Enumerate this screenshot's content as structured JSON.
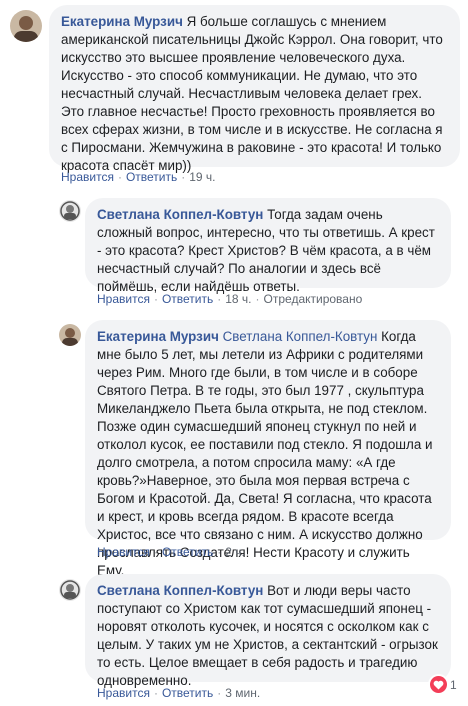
{
  "labels": {
    "like": "Нравится",
    "reply": "Ответить",
    "edited": "Отредактировано"
  },
  "comments": [
    {
      "author": "Екатерина Мурзич",
      "text": "Я больше соглашусь с мнением американской писательницы Джойс Кэррол. Она говорит, что искусство это высшее проявление человеческого духа. Искусство - это способ коммуникации. Не думаю, что это несчастный случай. Несчастливым человека делает грех. Это главное несчастье! Просто греховность проявляется во всех сферах жизни, в том числе и в искусстве. Не согласна я с Пиросмани. Жемчужина в раковине - это красота! И только красота спасёт мир))",
      "time": "19 ч."
    },
    {
      "author": "Светлана Коппел-Ковтун",
      "text": "Тогда задам очень сложный вопрос, интересно, что ты ответишь. А крест - это красота? Крест Христов? В чём красота, а в чём несчастный случай? По аналогии и здесь всё поймёшь, если найдёшь ответы.",
      "time": "18 ч."
    },
    {
      "author": "Екатерина Мурзич",
      "mention": "Светлана Коппел-Ковтун",
      "text": "Когда мне было 5 лет, мы летели из Африки с родителями через Рим. Много где были, в том числе и в соборе Святого Петра. В те годы, это был 1977 , скульптура Микеланджело Пьета была открыта, не под стеклом. Позже один сумасшедший японец стукнул по ней и отколол кусок, ее поставили под стекло. Я подошла и долго смотрела, а потом спросила маму: «А где кровь?»Наверное, это была моя первая встреча с Богом и Красотой. Да, Света! Я согласна, что красота и крест, и кровь всегда рядом. В красоте всегда Христос, все что связано с ним. А искусство должно прославлять Создателя! Нести Красоту и служить Ему.",
      "time": "2 ч."
    },
    {
      "author": "Светлана Коппел-Ковтун",
      "text": "Вот и люди веры часто поступают со Христом как тот сумасшедший японец - норовят отколоть кусочек, и носятся с осколком как с целым. У таких ум не Христов, а сектантский - огрызок то есть. Целое вмещает в себя радость и трагедию одновременно.",
      "time": "3 мин.",
      "reactions": "1"
    }
  ],
  "colors": {
    "link": "#385898",
    "bubble": "#f2f3f5",
    "meta": "#606770",
    "heart": "#f33e58"
  }
}
